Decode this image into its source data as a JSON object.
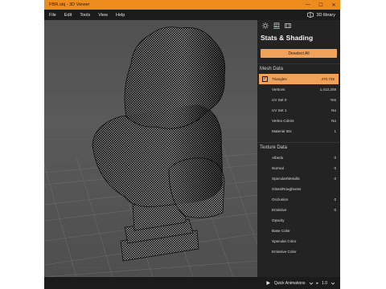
{
  "window": {
    "title": "PBR.obj - 3D Viewer",
    "controls": [
      "—",
      "☐",
      "✕"
    ]
  },
  "menu": [
    "File",
    "Edit",
    "Tools",
    "View",
    "Help"
  ],
  "library": {
    "label": "3D library",
    "icon": "library-icon"
  },
  "panel": {
    "tabs": [
      {
        "icon": "lighting-icon"
      },
      {
        "icon": "stats-shading-icon",
        "active": true
      },
      {
        "icon": "animation-icon"
      }
    ],
    "title": "Stats & Shading",
    "deselect_label": "Deselect All",
    "mesh": {
      "header": "Mesh Data",
      "rows": [
        {
          "label": "Triangles",
          "value": "470,736",
          "selected": true,
          "checked": true
        },
        {
          "label": "Vertices",
          "value": "1,412,208"
        },
        {
          "label": "UV Set 0",
          "value": "Yes"
        },
        {
          "label": "UV Set 1",
          "value": "No"
        },
        {
          "label": "Vertex Colors",
          "value": "No"
        },
        {
          "label": "Material IDs",
          "value": "1"
        }
      ]
    },
    "texture": {
      "header": "Texture Data",
      "rows": [
        {
          "label": "Albedo",
          "value": "0"
        },
        {
          "label": "Normal",
          "value": "0"
        },
        {
          "label": "Specular/Metallic",
          "value": "0"
        },
        {
          "label": "Gloss/Roughness",
          "value": ""
        },
        {
          "label": "Occlusion",
          "value": "0"
        },
        {
          "label": "Emissive",
          "value": "0"
        },
        {
          "label": "Opacity",
          "value": ""
        },
        {
          "label": "Base Color",
          "value": ""
        },
        {
          "label": "Specular Color",
          "value": ""
        },
        {
          "label": "Emissive Color",
          "value": ""
        }
      ]
    }
  },
  "status": {
    "quick_animations": "Quick Animations",
    "zoom": "1.0"
  },
  "colors": {
    "accent": "#ee8b1d",
    "selection": "#f0a15a",
    "panel": "#232323"
  }
}
